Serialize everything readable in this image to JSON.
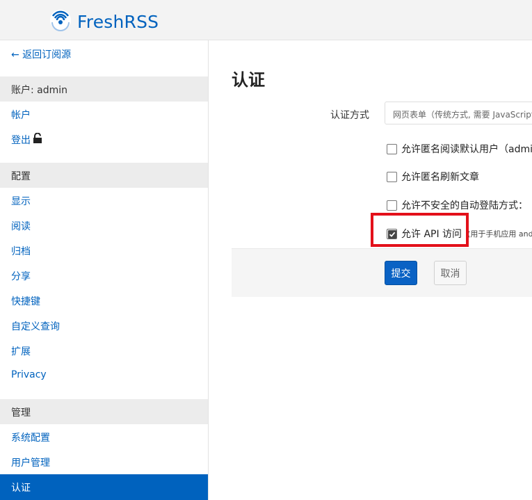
{
  "app": {
    "name": "FreshRSS",
    "brand_color": "#0062be"
  },
  "sidebar": {
    "back_link": "← 返回订阅源",
    "account_section": "账户: admin",
    "account_items": [
      "帐户",
      "登出"
    ],
    "config_section": "配置",
    "config_items": [
      "显示",
      "阅读",
      "归档",
      "分享",
      "快捷键",
      "自定义查询",
      "扩展",
      "Privacy"
    ],
    "admin_section": "管理",
    "admin_items": [
      "系统配置",
      "用户管理"
    ],
    "active_item": "认证"
  },
  "main": {
    "title": "认证",
    "auth_method_label": "认证方式",
    "auth_method_value": "网页表单（传统方式, 需要 JavaScript）",
    "checkboxes": [
      {
        "label": "允许匿名阅读默认用户（admin）",
        "checked": false
      },
      {
        "label": "允许匿名刷新文章",
        "checked": false
      },
      {
        "label": "允许不安全的自动登陆方式：",
        "checked": false
      },
      {
        "label": "允许 API 访问",
        "hint": "(用于手机应用 and",
        "checked": true
      }
    ],
    "submit_label": "提交",
    "cancel_label": "取消"
  },
  "colors": {
    "highlight": "#e3101a",
    "active_bg": "#0062be"
  }
}
